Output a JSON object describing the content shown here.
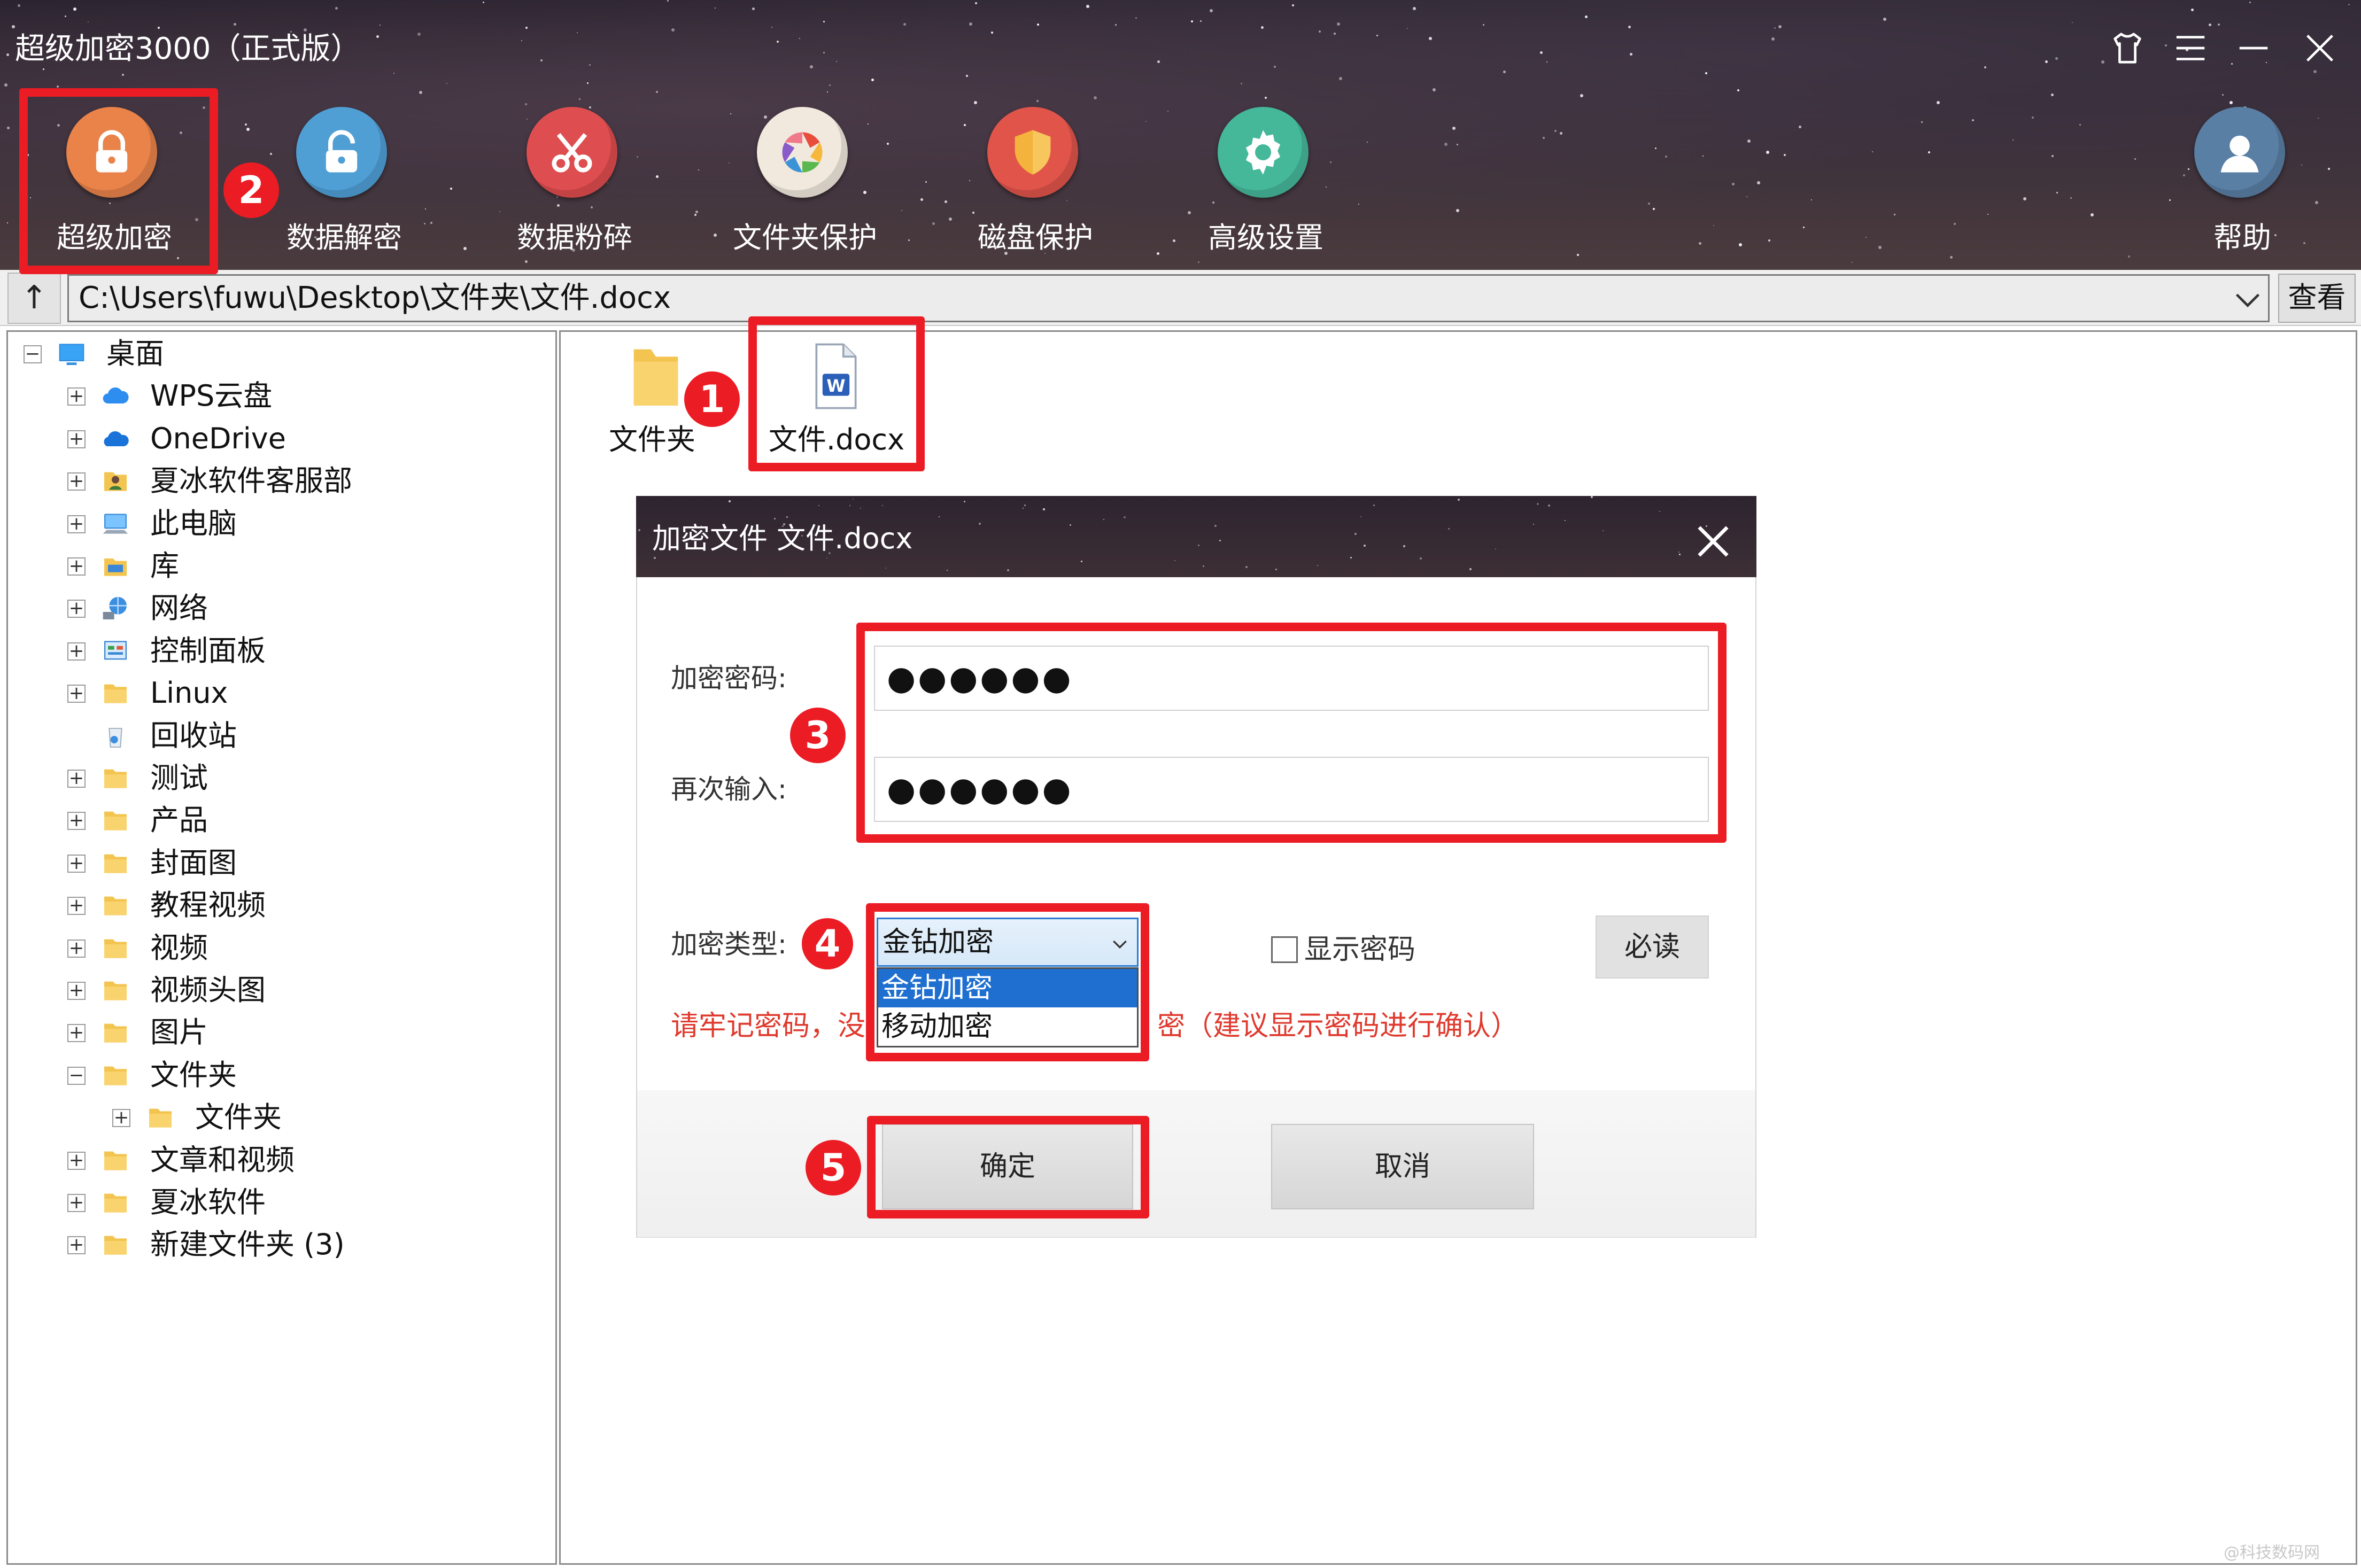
{
  "window": {
    "title": "超级加密3000（正式版）"
  },
  "toolbar": {
    "items": [
      {
        "label": "超级加密",
        "icon": "padlock-icon",
        "color": "#e9834a"
      },
      {
        "label": "数据解密",
        "icon": "padlock-open-icon",
        "color": "#4f9fd5"
      },
      {
        "label": "数据粉碎",
        "icon": "scissors-icon",
        "color": "#de4d4f"
      },
      {
        "label": "文件夹保护",
        "icon": "aperture-icon",
        "color": "#f1e9dd"
      },
      {
        "label": "磁盘保护",
        "icon": "shield-icon",
        "color": "#e0544a"
      },
      {
        "label": "高级设置",
        "icon": "gear-icon",
        "color": "#45b89a"
      },
      {
        "label": "帮助",
        "icon": "user-icon",
        "color": "#5a7fa4"
      }
    ]
  },
  "pathbar": {
    "up_label": "↑",
    "path": "C:\\Users\\fuwu\\Desktop\\文件夹\\文件.docx",
    "view_label": "查看"
  },
  "tree": {
    "items": [
      {
        "label": "桌面",
        "expander": "−",
        "icon": "desktop-icon"
      },
      {
        "label": "WPS云盘",
        "expander": "+",
        "icon": "cloud-icon"
      },
      {
        "label": "OneDrive",
        "expander": "+",
        "icon": "onedrive-icon"
      },
      {
        "label": "夏冰软件客服部",
        "expander": "+",
        "icon": "user-folder-icon"
      },
      {
        "label": "此电脑",
        "expander": "+",
        "icon": "computer-icon"
      },
      {
        "label": "库",
        "expander": "+",
        "icon": "library-icon"
      },
      {
        "label": "网络",
        "expander": "+",
        "icon": "network-icon"
      },
      {
        "label": "控制面板",
        "expander": "+",
        "icon": "control-panel-icon"
      },
      {
        "label": "Linux",
        "expander": "+",
        "icon": "folder-icon"
      },
      {
        "label": "回收站",
        "expander": "",
        "icon": "recycle-bin-icon"
      },
      {
        "label": "测试",
        "expander": "+",
        "icon": "folder-icon"
      },
      {
        "label": "产品",
        "expander": "+",
        "icon": "folder-icon"
      },
      {
        "label": "封面图",
        "expander": "+",
        "icon": "folder-icon"
      },
      {
        "label": "教程视频",
        "expander": "+",
        "icon": "folder-icon"
      },
      {
        "label": "视频",
        "expander": "+",
        "icon": "folder-icon"
      },
      {
        "label": "视频头图",
        "expander": "+",
        "icon": "folder-icon"
      },
      {
        "label": "图片",
        "expander": "+",
        "icon": "folder-icon"
      },
      {
        "label": "文件夹",
        "expander": "−",
        "icon": "folder-icon"
      },
      {
        "label": "文件夹",
        "expander": "+",
        "icon": "folder-icon"
      },
      {
        "label": "文章和视频",
        "expander": "+",
        "icon": "folder-icon"
      },
      {
        "label": "夏冰软件",
        "expander": "+",
        "icon": "folder-icon"
      },
      {
        "label": "新建文件夹 (3)",
        "expander": "+",
        "icon": "folder-icon"
      }
    ]
  },
  "files": [
    {
      "label": "文件夹",
      "icon": "folder-icon"
    },
    {
      "label": "文件.docx",
      "icon": "word-doc-icon"
    }
  ],
  "dialog": {
    "title": "加密文件  文件.docx",
    "password_label": "加密密码:",
    "password_value": "●●●●●●",
    "confirm_label": "再次输入:",
    "confirm_value": "●●●●●●",
    "type_label": "加密类型:",
    "type_selected": "金钻加密",
    "type_options": [
      "金钻加密",
      "移动加密"
    ],
    "show_password_label": "显示密码",
    "must_read_label": "必读",
    "warning_left": "请牢记密码，没",
    "warning_right": "密（建议显示密码进行确认）",
    "ok_label": "确定",
    "cancel_label": "取消"
  },
  "annotations": {
    "badges": [
      "1",
      "2",
      "3",
      "4",
      "5"
    ]
  },
  "watermark": "@科技数码网"
}
